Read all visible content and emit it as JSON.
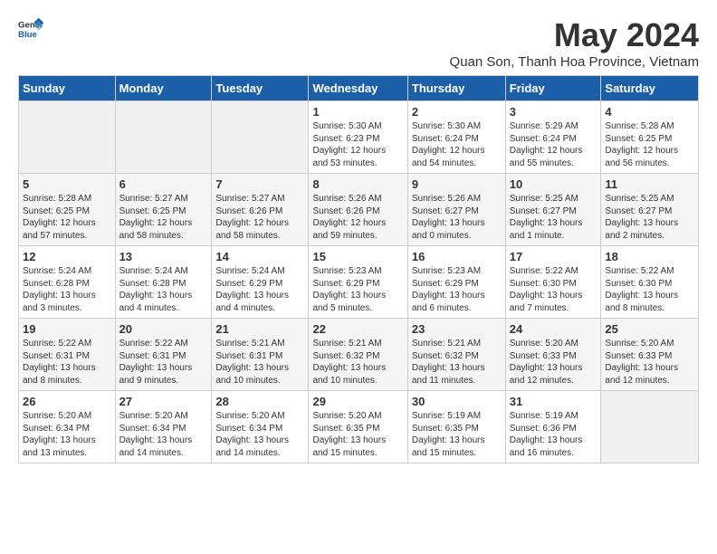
{
  "logo": {
    "general": "General",
    "blue": "Blue"
  },
  "header": {
    "month_year": "May 2024",
    "location": "Quan Son, Thanh Hoa Province, Vietnam"
  },
  "weekdays": [
    "Sunday",
    "Monday",
    "Tuesday",
    "Wednesday",
    "Thursday",
    "Friday",
    "Saturday"
  ],
  "weeks": [
    [
      {
        "day": "",
        "info": ""
      },
      {
        "day": "",
        "info": ""
      },
      {
        "day": "",
        "info": ""
      },
      {
        "day": "1",
        "info": "Sunrise: 5:30 AM\nSunset: 6:23 PM\nDaylight: 12 hours\nand 53 minutes."
      },
      {
        "day": "2",
        "info": "Sunrise: 5:30 AM\nSunset: 6:24 PM\nDaylight: 12 hours\nand 54 minutes."
      },
      {
        "day": "3",
        "info": "Sunrise: 5:29 AM\nSunset: 6:24 PM\nDaylight: 12 hours\nand 55 minutes."
      },
      {
        "day": "4",
        "info": "Sunrise: 5:28 AM\nSunset: 6:25 PM\nDaylight: 12 hours\nand 56 minutes."
      }
    ],
    [
      {
        "day": "5",
        "info": "Sunrise: 5:28 AM\nSunset: 6:25 PM\nDaylight: 12 hours\nand 57 minutes."
      },
      {
        "day": "6",
        "info": "Sunrise: 5:27 AM\nSunset: 6:25 PM\nDaylight: 12 hours\nand 58 minutes."
      },
      {
        "day": "7",
        "info": "Sunrise: 5:27 AM\nSunset: 6:26 PM\nDaylight: 12 hours\nand 58 minutes."
      },
      {
        "day": "8",
        "info": "Sunrise: 5:26 AM\nSunset: 6:26 PM\nDaylight: 12 hours\nand 59 minutes."
      },
      {
        "day": "9",
        "info": "Sunrise: 5:26 AM\nSunset: 6:27 PM\nDaylight: 13 hours\nand 0 minutes."
      },
      {
        "day": "10",
        "info": "Sunrise: 5:25 AM\nSunset: 6:27 PM\nDaylight: 13 hours\nand 1 minute."
      },
      {
        "day": "11",
        "info": "Sunrise: 5:25 AM\nSunset: 6:27 PM\nDaylight: 13 hours\nand 2 minutes."
      }
    ],
    [
      {
        "day": "12",
        "info": "Sunrise: 5:24 AM\nSunset: 6:28 PM\nDaylight: 13 hours\nand 3 minutes."
      },
      {
        "day": "13",
        "info": "Sunrise: 5:24 AM\nSunset: 6:28 PM\nDaylight: 13 hours\nand 4 minutes."
      },
      {
        "day": "14",
        "info": "Sunrise: 5:24 AM\nSunset: 6:29 PM\nDaylight: 13 hours\nand 4 minutes."
      },
      {
        "day": "15",
        "info": "Sunrise: 5:23 AM\nSunset: 6:29 PM\nDaylight: 13 hours\nand 5 minutes."
      },
      {
        "day": "16",
        "info": "Sunrise: 5:23 AM\nSunset: 6:29 PM\nDaylight: 13 hours\nand 6 minutes."
      },
      {
        "day": "17",
        "info": "Sunrise: 5:22 AM\nSunset: 6:30 PM\nDaylight: 13 hours\nand 7 minutes."
      },
      {
        "day": "18",
        "info": "Sunrise: 5:22 AM\nSunset: 6:30 PM\nDaylight: 13 hours\nand 8 minutes."
      }
    ],
    [
      {
        "day": "19",
        "info": "Sunrise: 5:22 AM\nSunset: 6:31 PM\nDaylight: 13 hours\nand 8 minutes."
      },
      {
        "day": "20",
        "info": "Sunrise: 5:22 AM\nSunset: 6:31 PM\nDaylight: 13 hours\nand 9 minutes."
      },
      {
        "day": "21",
        "info": "Sunrise: 5:21 AM\nSunset: 6:31 PM\nDaylight: 13 hours\nand 10 minutes."
      },
      {
        "day": "22",
        "info": "Sunrise: 5:21 AM\nSunset: 6:32 PM\nDaylight: 13 hours\nand 10 minutes."
      },
      {
        "day": "23",
        "info": "Sunrise: 5:21 AM\nSunset: 6:32 PM\nDaylight: 13 hours\nand 11 minutes."
      },
      {
        "day": "24",
        "info": "Sunrise: 5:20 AM\nSunset: 6:33 PM\nDaylight: 13 hours\nand 12 minutes."
      },
      {
        "day": "25",
        "info": "Sunrise: 5:20 AM\nSunset: 6:33 PM\nDaylight: 13 hours\nand 12 minutes."
      }
    ],
    [
      {
        "day": "26",
        "info": "Sunrise: 5:20 AM\nSunset: 6:34 PM\nDaylight: 13 hours\nand 13 minutes."
      },
      {
        "day": "27",
        "info": "Sunrise: 5:20 AM\nSunset: 6:34 PM\nDaylight: 13 hours\nand 14 minutes."
      },
      {
        "day": "28",
        "info": "Sunrise: 5:20 AM\nSunset: 6:34 PM\nDaylight: 13 hours\nand 14 minutes."
      },
      {
        "day": "29",
        "info": "Sunrise: 5:20 AM\nSunset: 6:35 PM\nDaylight: 13 hours\nand 15 minutes."
      },
      {
        "day": "30",
        "info": "Sunrise: 5:19 AM\nSunset: 6:35 PM\nDaylight: 13 hours\nand 15 minutes."
      },
      {
        "day": "31",
        "info": "Sunrise: 5:19 AM\nSunset: 6:36 PM\nDaylight: 13 hours\nand 16 minutes."
      },
      {
        "day": "",
        "info": ""
      }
    ]
  ]
}
